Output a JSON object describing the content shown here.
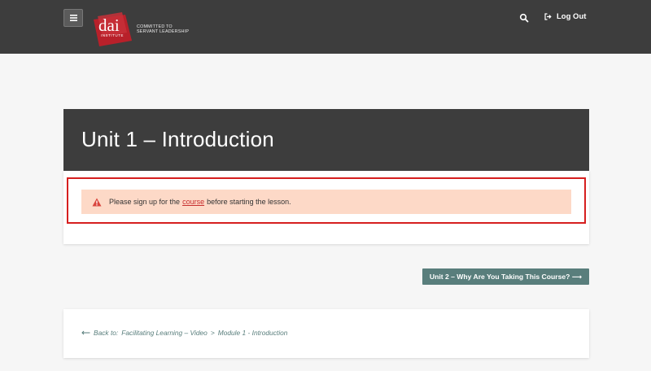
{
  "header": {
    "logo_text": "dai",
    "logo_sub": "INSTITUTE",
    "tagline_line1": "COMMITTED TO",
    "tagline_line2": "SERVANT LEADERSHIP",
    "logout_label": "Log Out"
  },
  "lesson": {
    "title": "Unit 1 – Introduction",
    "notice_prefix": "Please sign up for the",
    "notice_link": "course",
    "notice_suffix": "before starting the lesson."
  },
  "navigation": {
    "next_label": "Unit 2 – Why Are You Taking This Course? ⟶",
    "back_prefix": "Back to:",
    "back_course": "Facilitating Learning – Video",
    "back_separator": ">",
    "back_module": "Module 1 - Introduction"
  },
  "colors": {
    "header_bg": "#3d3d3d",
    "brand_red": "#b8202a",
    "accent_teal": "#597e7c",
    "notice_bg": "#fdd9c7",
    "highlight_border": "#d61f1f"
  },
  "icons": {
    "menu": "hamburger-menu-icon",
    "search": "search-icon",
    "logout": "logout-icon",
    "warning": "warning-triangle-icon",
    "back": "arrow-left-icon"
  }
}
